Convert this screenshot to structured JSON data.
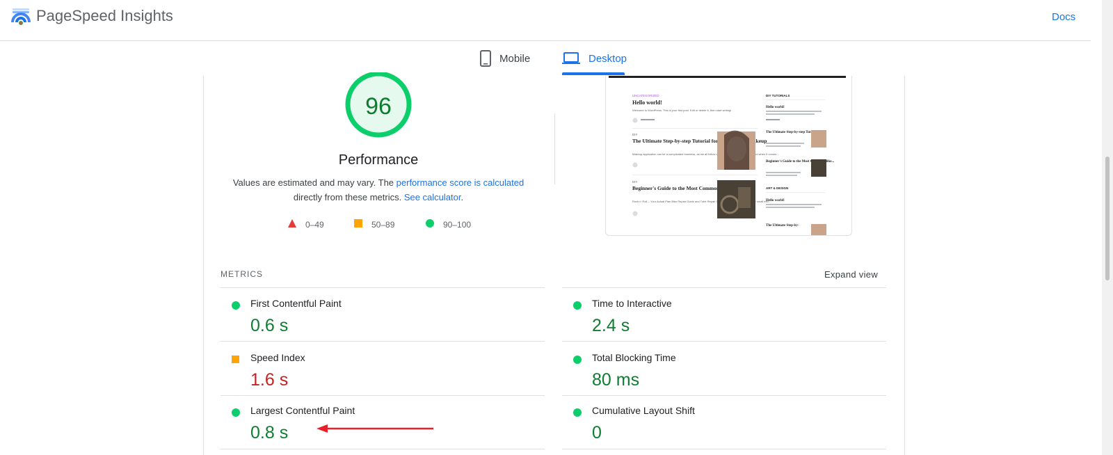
{
  "app": {
    "title": "PageSpeed Insights",
    "docs_label": "Docs"
  },
  "tabs": [
    {
      "label": "Mobile",
      "icon": "phone-icon",
      "active": false
    },
    {
      "label": "Desktop",
      "icon": "laptop-icon",
      "active": true
    }
  ],
  "performance": {
    "score": "96",
    "title": "Performance",
    "desc_prefix": "Values are estimated and may vary. The ",
    "desc_link1": "performance score is calculated",
    "desc_middle": " directly from these metrics. ",
    "desc_link2": "See calculator",
    "desc_suffix": "."
  },
  "legend": [
    {
      "label": "0–49",
      "icon": "red-triangle-icon",
      "color": "#e53935"
    },
    {
      "label": "50–89",
      "icon": "orange-square-icon",
      "color": "#ffa400"
    },
    {
      "label": "90–100",
      "icon": "green-circle-icon",
      "color": "#0cce6b"
    }
  ],
  "screenshot": {
    "category1": "UNCATEGORIZED",
    "post1_title": "Hello world!",
    "post1_excerpt": "Welcome to WordPress. This is your first post. Edit or delete it, then start writing!",
    "category2": "DIY",
    "post2_title": "The Ultimate Step-by-step Tutorial for Perfect Face Makeup",
    "post2_excerpt": "Makeup application can be a complicated business, as we all follow our own set of rules and preferred when it comes...",
    "category3": "DIY",
    "post3_title": "Beginner's Guide to the Most Common Bike Repairs",
    "post3_excerpt": "Rock n' Roll -- Your Actual Plan Bike Repair Guide and Tube Repair Guide. Another handy feat is the small info...",
    "side_heading": "DIY TUTORIALS",
    "side1_title": "Hello world!",
    "side2_title": "The Ultimate Step-by-step Tutorial for...",
    "side3_title": "Beginner's Guide to the Most Common Bike...",
    "side_heading2": "ART & DESIGN",
    "side4_title": "Hello world!",
    "side5_title": "The Ultimate Step-by-"
  },
  "metrics": {
    "label": "METRICS",
    "expand_label": "Expand view",
    "items": [
      {
        "name": "First Contentful Paint",
        "value": "0.6 s",
        "rating": "good"
      },
      {
        "name": "Time to Interactive",
        "value": "2.4 s",
        "rating": "good"
      },
      {
        "name": "Speed Index",
        "value": "1.6 s",
        "rating": "average"
      },
      {
        "name": "Total Blocking Time",
        "value": "80 ms",
        "rating": "good"
      },
      {
        "name": "Largest Contentful Paint",
        "value": "0.8 s",
        "rating": "good"
      },
      {
        "name": "Cumulative Layout Shift",
        "value": "0",
        "rating": "good"
      }
    ]
  },
  "colors": {
    "accent": "#1a73e8",
    "good": "#0cce6b",
    "good_text": "#0d7e2f",
    "average": "#ffa400",
    "poor_text": "#c5221f",
    "annotation_arrow": "#e8202a"
  }
}
